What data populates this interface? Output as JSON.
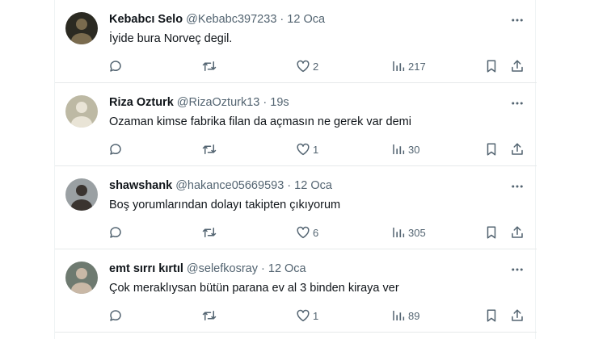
{
  "tweets": [
    {
      "name": "Kebabcı Selo",
      "handle": "@Kebabc397233",
      "separator": "·",
      "time": "12 Oca",
      "text": "İyide bura Norveç degil.",
      "likes": "2",
      "views": "217",
      "avatar": {
        "bg": "#2b2a22",
        "fg": "#7a6b4e"
      }
    },
    {
      "name": "Riza Ozturk",
      "handle": "@RizaOzturk13",
      "separator": "·",
      "time": "19s",
      "text": "Ozaman kimse fabrika filan da açmasın ne gerek var demi",
      "likes": "1",
      "views": "30",
      "avatar": {
        "bg": "#bdb9a4",
        "fg": "#e9e4d6"
      }
    },
    {
      "name": "shawshank",
      "handle": "@hakance05669593",
      "separator": "·",
      "time": "12 Oca",
      "text": "Boş yorumlarından dolayı takipten çıkıyorum",
      "likes": "6",
      "views": "305",
      "avatar": {
        "bg": "#9aa0a3",
        "fg": "#3a3430"
      }
    },
    {
      "name": "emt sırrı kırtıl",
      "handle": "@selefkosray",
      "separator": "·",
      "time": "12 Oca",
      "text": "Çok meraklıysan bütün parana ev al 3 binden kiraya ver",
      "likes": "1",
      "views": "89",
      "avatar": {
        "bg": "#6e7a70",
        "fg": "#c9b8a6"
      }
    }
  ],
  "icons": {
    "more": "more-icon",
    "reply": "reply-icon",
    "retweet": "retweet-icon",
    "like": "heart-icon",
    "views": "views-icon",
    "bookmark": "bookmark-icon",
    "share": "share-icon"
  },
  "colors": {
    "text": "#0f1419",
    "secondary": "#536471",
    "divider": "#e6e9ea"
  }
}
